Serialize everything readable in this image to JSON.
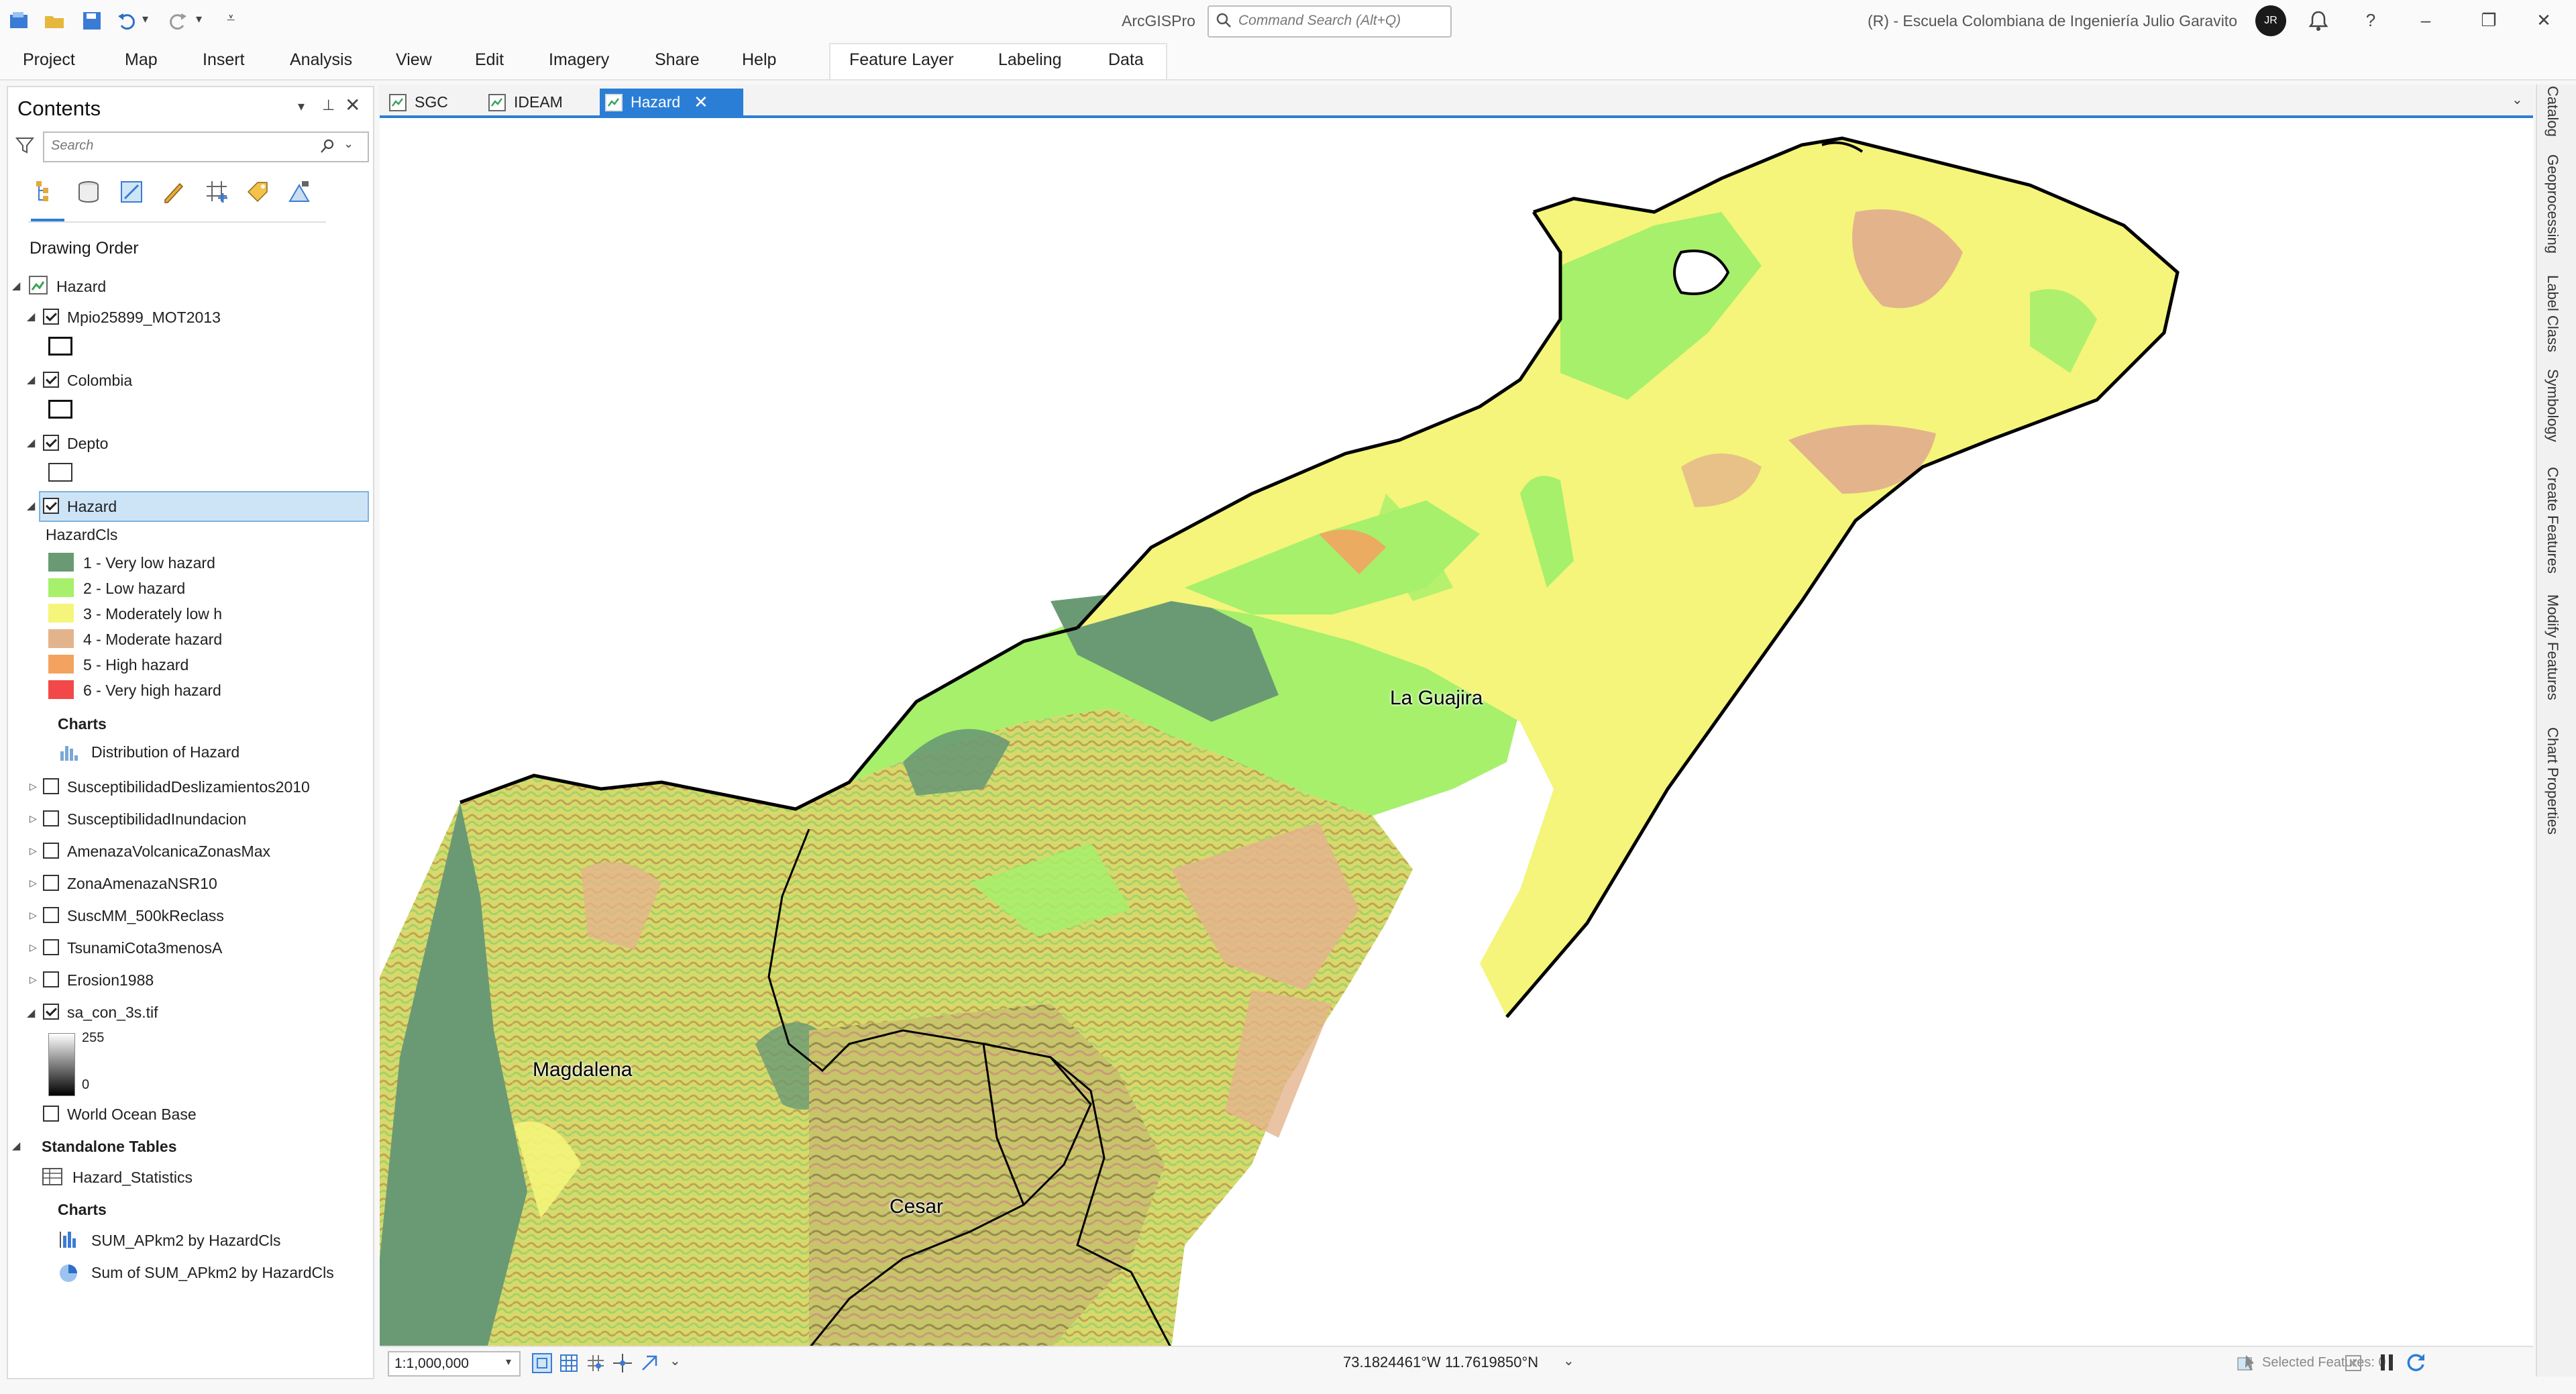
{
  "app": {
    "title": "ArcGISPro",
    "command_search_placeholder": "Command Search (Alt+Q)",
    "org": "(R) - Escuela Colombiana de Ingeniería Julio Garavito",
    "avatar_initials": "JR",
    "help": "?"
  },
  "ribbon": {
    "tabs": [
      "Project",
      "Map",
      "Insert",
      "Analysis",
      "View",
      "Edit",
      "Imagery",
      "Share",
      "Help"
    ],
    "context_tabs": [
      "Feature Layer",
      "Labeling",
      "Data"
    ]
  },
  "contents": {
    "title": "Contents",
    "search_placeholder": "Search",
    "drawing_order_label": "Drawing Order",
    "map_name": "Hazard",
    "layers": {
      "mpio": "Mpio25899_MOT2013",
      "colombia": "Colombia",
      "depto": "Depto",
      "hazard": "Hazard"
    },
    "legend_field": "HazardCls",
    "legend": [
      {
        "label": "1 - Very low hazard",
        "color": "#6a9a74"
      },
      {
        "label": "2 - Low hazard",
        "color": "#a6f06b"
      },
      {
        "label": "3 - Moderately low h",
        "color": "#f4f57a"
      },
      {
        "label": "4 - Moderate hazard",
        "color": "#e3b48c"
      },
      {
        "label": "5 - High hazard",
        "color": "#f3a35f"
      },
      {
        "label": "6 - Very high hazard",
        "color": "#f24848"
      }
    ],
    "charts_label": "Charts",
    "hazard_chart": "Distribution of Hazard",
    "other_layers": [
      "SusceptibilidadDeslizamientos2010",
      "SusceptibilidadInundacion",
      "AmenazaVolcanicaZonasMax",
      "ZonaAmenazaNSR10",
      "SuscMM_500kReclass",
      "TsunamiCota3menosA",
      "Erosion1988"
    ],
    "raster_layer": "sa_con_3s.tif",
    "raster_max": "255",
    "raster_min": "0",
    "basemap": "World Ocean Base",
    "standalone_label": "Standalone Tables",
    "table_name": "Hazard_Statistics",
    "table_charts_label": "Charts",
    "table_charts": [
      "SUM_APkm2 by HazardCls",
      "Sum of SUM_APkm2 by HazardCls"
    ]
  },
  "view_tabs": [
    "SGC",
    "IDEAM",
    "Hazard"
  ],
  "map": {
    "labels": [
      "La Guajira",
      "Magdalena",
      "Cesar"
    ]
  },
  "status": {
    "scale": "1:1,000,000",
    "coordinates": "73.1824461°W 11.7619850°N",
    "selected_features": "Selected Features: 0"
  },
  "right_rail": [
    "Catalog",
    "Geoprocessing",
    "Label Class",
    "Symbology",
    "Create Features",
    "Modify Features",
    "Chart Properties"
  ]
}
